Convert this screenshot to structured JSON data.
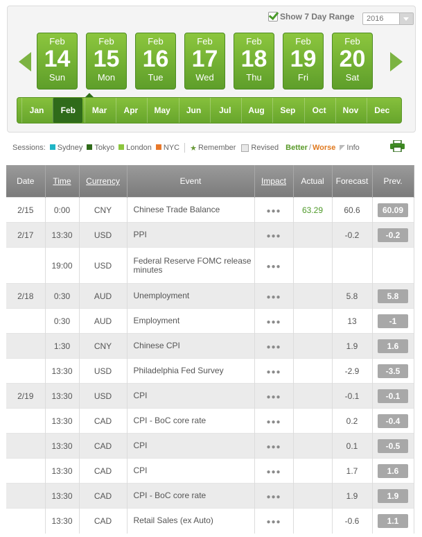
{
  "header": {
    "show_range_label": "Show 7 Day Range",
    "year": "2016"
  },
  "days": [
    {
      "month": "Feb",
      "day": "14",
      "weekday": "Sun"
    },
    {
      "month": "Feb",
      "day": "15",
      "weekday": "Mon"
    },
    {
      "month": "Feb",
      "day": "16",
      "weekday": "Tue"
    },
    {
      "month": "Feb",
      "day": "17",
      "weekday": "Wed"
    },
    {
      "month": "Feb",
      "day": "18",
      "weekday": "Thu"
    },
    {
      "month": "Feb",
      "day": "19",
      "weekday": "Fri"
    },
    {
      "month": "Feb",
      "day": "20",
      "weekday": "Sat"
    }
  ],
  "months": [
    "Jan",
    "Feb",
    "Mar",
    "Apr",
    "May",
    "Jun",
    "Jul",
    "Aug",
    "Sep",
    "Oct",
    "Nov",
    "Dec"
  ],
  "active_month": "Feb",
  "legend": {
    "sessions_label": "Sessions:",
    "sessions": [
      {
        "name": "Sydney",
        "color": "#1fb5c6"
      },
      {
        "name": "Tokyo",
        "color": "#2f6b1a"
      },
      {
        "name": "London",
        "color": "#8cc63e"
      },
      {
        "name": "NYC",
        "color": "#e8782a"
      }
    ],
    "remember": "Remember",
    "revised": "Revised",
    "better": "Better",
    "slash": "/",
    "worse": "Worse",
    "info": "Info"
  },
  "table": {
    "headers": {
      "date": "Date",
      "time": "Time",
      "currency": "Currency",
      "event": "Event",
      "impact": "Impact",
      "actual": "Actual",
      "forecast": "Forecast",
      "prev": "Prev."
    },
    "impact_glyph": "●●●",
    "rows": [
      {
        "date": "2/15",
        "time": "0:00",
        "currency": "CNY",
        "event": "Chinese Trade Balance",
        "actual": "63.29",
        "forecast": "60.6",
        "prev": "60.09"
      },
      {
        "date": "2/17",
        "time": "13:30",
        "currency": "USD",
        "event": "PPI",
        "actual": "",
        "forecast": "-0.2",
        "prev": "-0.2"
      },
      {
        "date": "",
        "time": "19:00",
        "currency": "USD",
        "event": "Federal Reserve FOMC release minutes",
        "actual": "",
        "forecast": "",
        "prev": ""
      },
      {
        "date": "2/18",
        "time": "0:30",
        "currency": "AUD",
        "event": "Unemployment",
        "actual": "",
        "forecast": "5.8",
        "prev": "5.8"
      },
      {
        "date": "",
        "time": "0:30",
        "currency": "AUD",
        "event": "Employment",
        "actual": "",
        "forecast": "13",
        "prev": "-1"
      },
      {
        "date": "",
        "time": "1:30",
        "currency": "CNY",
        "event": "Chinese CPI",
        "actual": "",
        "forecast": "1.9",
        "prev": "1.6"
      },
      {
        "date": "",
        "time": "13:30",
        "currency": "USD",
        "event": "Philadelphia Fed Survey",
        "actual": "",
        "forecast": "-2.9",
        "prev": "-3.5"
      },
      {
        "date": "2/19",
        "time": "13:30",
        "currency": "USD",
        "event": "CPI",
        "actual": "",
        "forecast": "-0.1",
        "prev": "-0.1"
      },
      {
        "date": "",
        "time": "13:30",
        "currency": "CAD",
        "event": "CPI - BoC core rate",
        "actual": "",
        "forecast": "0.2",
        "prev": "-0.4"
      },
      {
        "date": "",
        "time": "13:30",
        "currency": "CAD",
        "event": "CPI",
        "actual": "",
        "forecast": "0.1",
        "prev": "-0.5"
      },
      {
        "date": "",
        "time": "13:30",
        "currency": "CAD",
        "event": "CPI",
        "actual": "",
        "forecast": "1.7",
        "prev": "1.6"
      },
      {
        "date": "",
        "time": "13:30",
        "currency": "CAD",
        "event": "CPI - BoC core rate",
        "actual": "",
        "forecast": "1.9",
        "prev": "1.9"
      },
      {
        "date": "",
        "time": "13:30",
        "currency": "CAD",
        "event": "Retail Sales (ex Auto)",
        "actual": "",
        "forecast": "-0.6",
        "prev": "1.1"
      }
    ]
  }
}
